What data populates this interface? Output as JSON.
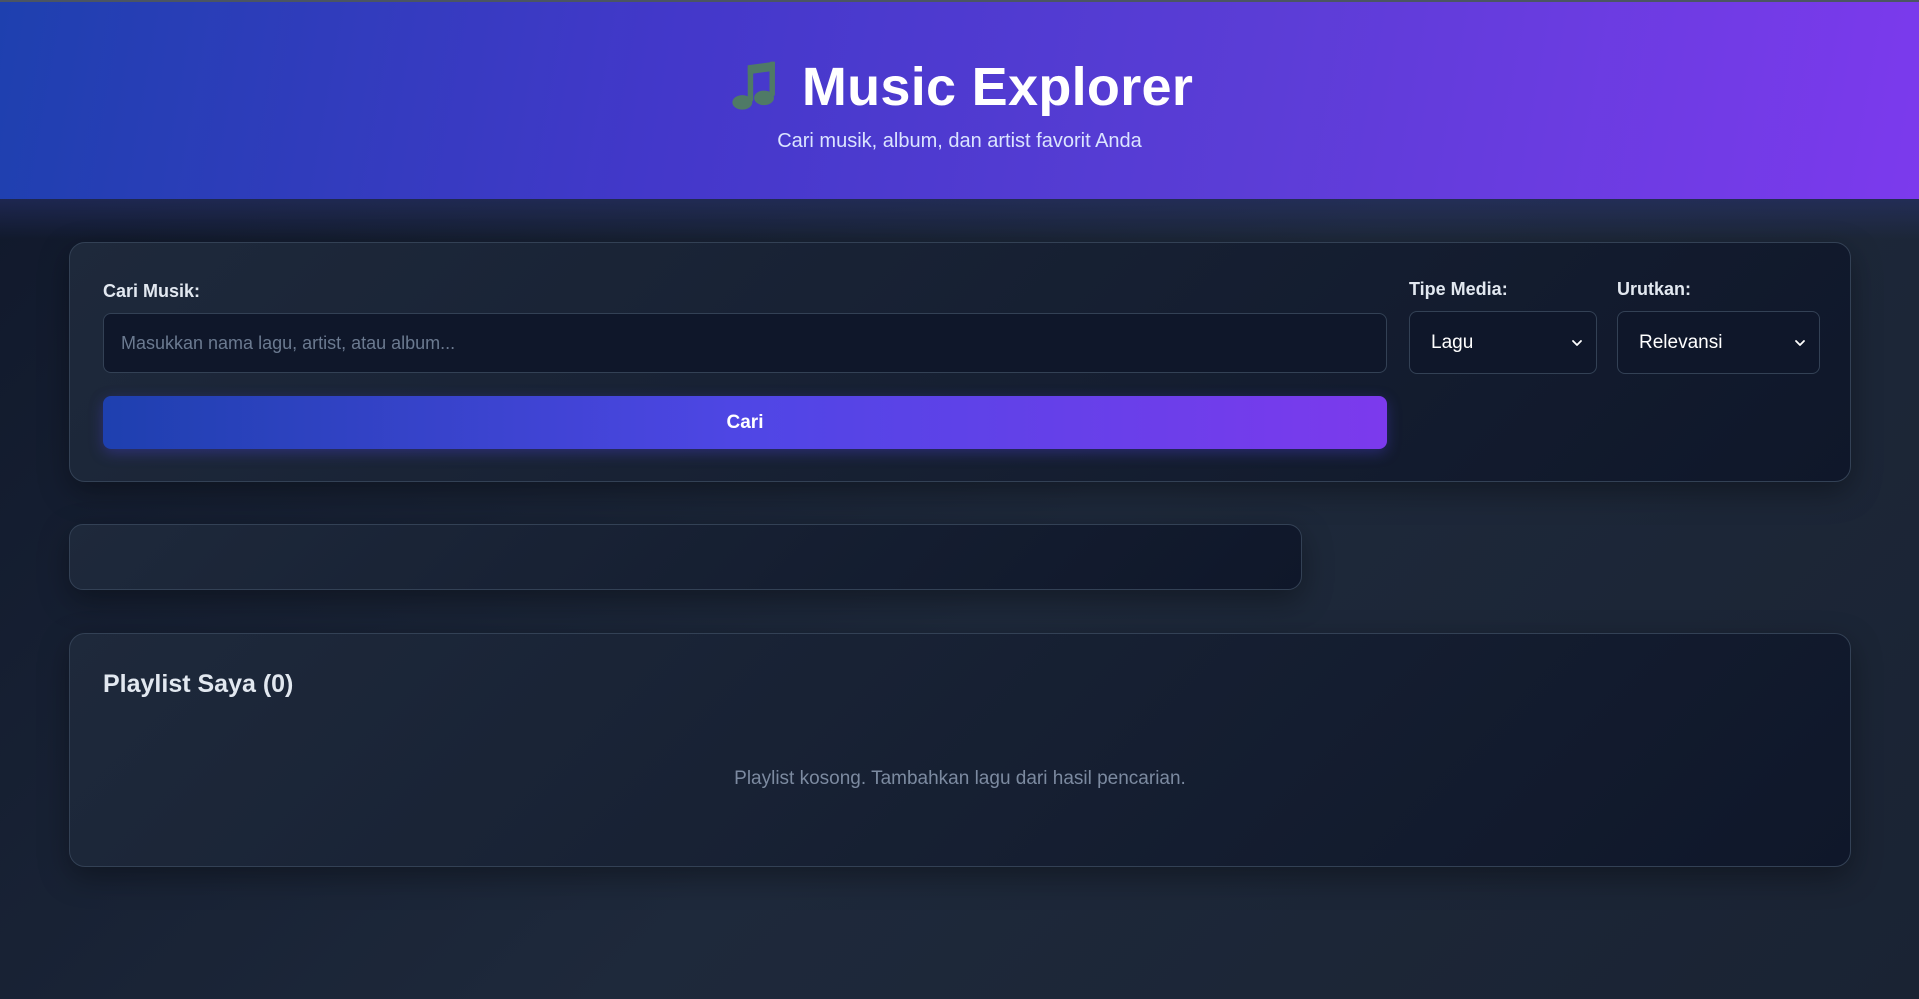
{
  "header": {
    "icon": "music-note-icon",
    "title": "Music Explorer",
    "subtitle": "Cari musik, album, dan artist favorit Anda"
  },
  "search": {
    "label": "Cari Musik:",
    "placeholder": "Masukkan nama lagu, artist, atau album...",
    "value": "",
    "button_label": "Cari"
  },
  "filters": {
    "media_label": "Tipe Media:",
    "media_selected": "Lagu",
    "sort_label": "Urutkan:",
    "sort_selected": "Relevansi"
  },
  "playlist": {
    "title": "Playlist Saya (0)",
    "empty_message": "Playlist kosong. Tambahkan lagu dari hasil pencarian."
  },
  "colors": {
    "accent_start": "#1e40af",
    "accent_end": "#7c3aed",
    "background": "#0f172a",
    "card": "#1e293b"
  }
}
